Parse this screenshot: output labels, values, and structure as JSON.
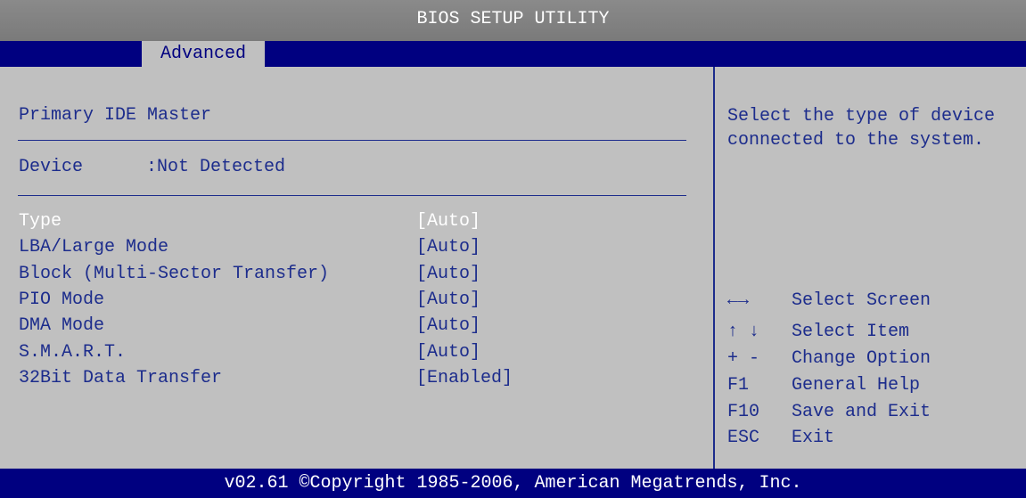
{
  "header": {
    "title": "BIOS SETUP UTILITY"
  },
  "tabs": [
    {
      "label": "Advanced",
      "active": true
    }
  ],
  "main": {
    "section_title": "Primary IDE Master",
    "device_label": "Device",
    "device_value": ":Not Detected",
    "settings": [
      {
        "label": "Type",
        "value": "[Auto]",
        "selected": true
      },
      {
        "label": "LBA/Large Mode",
        "value": "[Auto]"
      },
      {
        "label": "Block (Multi-Sector Transfer)",
        "value": "[Auto]"
      },
      {
        "label": "PIO Mode",
        "value": "[Auto]"
      },
      {
        "label": "DMA Mode",
        "value": "[Auto]"
      },
      {
        "label": "S.M.A.R.T.",
        "value": "[Auto]"
      },
      {
        "label": "32Bit Data Transfer",
        "value": "[Enabled]"
      }
    ]
  },
  "help": {
    "description": "Select the type of device connected to the system.",
    "keys": [
      {
        "key": "←→",
        "action": "Select Screen"
      },
      {
        "key": "↑ ↓",
        "action": "Select Item"
      },
      {
        "key": "+ -",
        "action": "Change Option"
      },
      {
        "key": "F1",
        "action": "General Help"
      },
      {
        "key": "F10",
        "action": "Save and Exit"
      },
      {
        "key": "ESC",
        "action": "Exit"
      }
    ]
  },
  "footer": {
    "text": "v02.61 ©Copyright 1985-2006, American Megatrends, Inc."
  },
  "colors": {
    "background": "#c0c0c0",
    "navy": "#000080",
    "text_blue": "#1c2c8c",
    "highlight": "#ffffff",
    "title_gray": "#808080"
  }
}
